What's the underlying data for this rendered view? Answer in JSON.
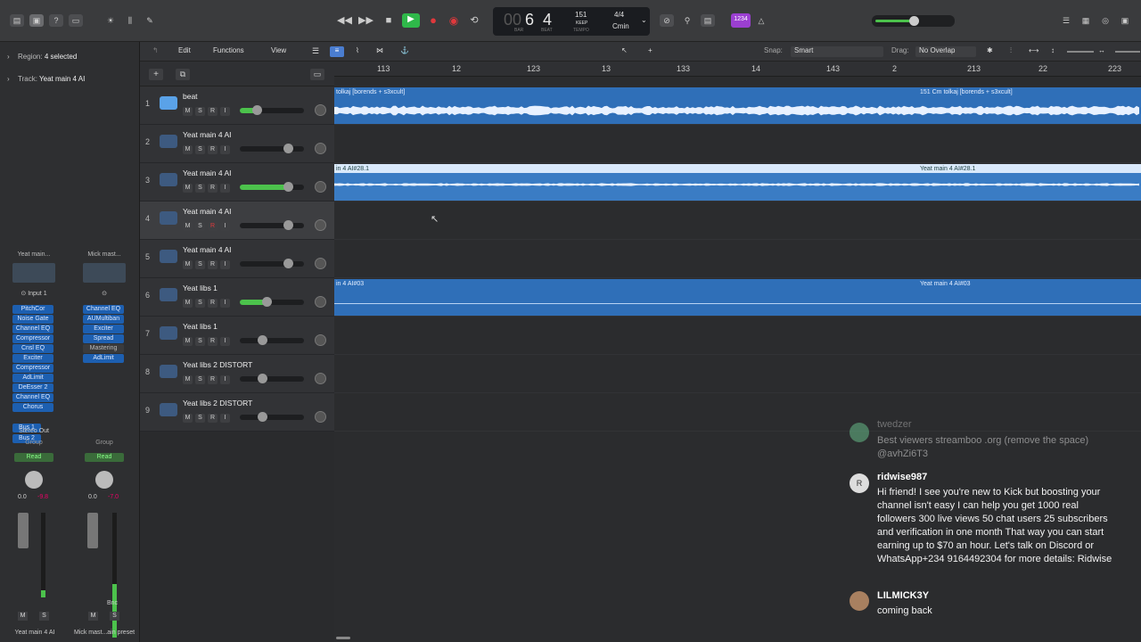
{
  "inspector": {
    "region_label": "Region:",
    "region_value": "4 selected",
    "track_label": "Track:",
    "track_value": "Yeat main 4 AI",
    "strip1": {
      "name": "Yeat main...",
      "input": "Input 1",
      "plugins": [
        "PitchCor",
        "Noise Gate",
        "Channel EQ",
        "Compressor",
        "Cnsl EQ",
        "Exciter",
        "Compressor",
        "AdLimit",
        "DeEsser 2",
        "Channel EQ",
        "Chorus"
      ],
      "sends": [
        "Bus 1",
        "Bus 2"
      ],
      "output": "Stereo Out",
      "group": "Group",
      "automation": "Read",
      "vol_left": "0.0",
      "vol_right": "-9.8",
      "mute": "M",
      "solo": "S",
      "label": "Yeat main 4 AI"
    },
    "strip2": {
      "name": "Mick mast...",
      "plugins": [
        "Channel EQ",
        "AUMultiban",
        "Exciter",
        "Spread",
        "Mastering",
        "AdLimit"
      ],
      "group": "Group",
      "automation": "Read",
      "vol_left": "0.0",
      "vol_right": "-7.0",
      "bounce": "Bnc",
      "mute": "M",
      "solo": "S",
      "label": "Mick mast...ain preset"
    }
  },
  "lcd": {
    "bar": "6",
    "beat": "4",
    "tempo": "151",
    "tempo_sub": "KEEP",
    "signature": "4/4",
    "key": "Cmin",
    "lbl_bar": "BAR",
    "lbl_beat": "BEAT",
    "lbl_tempo": "TEMPO"
  },
  "topbar": {
    "count_in": "1234"
  },
  "toolbar": {
    "edit": "Edit",
    "functions": "Functions",
    "view": "View",
    "snap_label": "Snap:",
    "snap_value": "Smart",
    "drag_label": "Drag:",
    "drag_value": "No Overlap"
  },
  "ruler": [
    "113",
    "12",
    "123",
    "13",
    "133",
    "14",
    "143",
    "2",
    "213",
    "22",
    "223"
  ],
  "tracks": [
    {
      "num": "1",
      "name": "beat",
      "fader": 0.27,
      "green": true
    },
    {
      "num": "2",
      "name": "Yeat main 4 AI",
      "fader": 0.75,
      "green": false
    },
    {
      "num": "3",
      "name": "Yeat main 4 AI",
      "fader": 0.75,
      "green": true
    },
    {
      "num": "4",
      "name": "Yeat main 4 AI",
      "fader": 0.75,
      "green": false
    },
    {
      "num": "5",
      "name": "Yeat main 4 AI",
      "fader": 0.75,
      "green": false
    },
    {
      "num": "6",
      "name": "Yeat libs 1",
      "fader": 0.42,
      "green": true
    },
    {
      "num": "7",
      "name": "Yeat libs 1",
      "fader": 0.35,
      "green": false
    },
    {
      "num": "8",
      "name": "Yeat libs 2 DISTORT",
      "fader": 0.35,
      "green": false
    },
    {
      "num": "9",
      "name": "Yeat libs 2 DISTORT",
      "fader": 0.35,
      "green": false
    }
  ],
  "regions": {
    "r1a": "tolkaj [borends + s3xcult]",
    "r1b": "151 Cm tolkaj [borends + s3xcult]",
    "r3a": "in 4 AI#28.1",
    "r3b": "Yeat main 4 AI#28.1",
    "r6a": "in 4 AI#03",
    "r6b": "Yeat main 4 AI#03"
  },
  "chat": [
    {
      "user": "twedzer",
      "text": "Best viewers streamboo .org (remove the space) @avhZi6T3"
    },
    {
      "user": "ridwise987",
      "avatar_letter": "R",
      "text": "Hi friend! I see you're new to Kick but boosting your channel isn't easy I can help you get 1000 real followers 300 live views 50 chat users 25 subscribers and verification in one month That way you can start earning up to $70 an hour. Let's talk on Discord or WhatsApp+234 9164492304 for more details: Ridwise"
    },
    {
      "user": "LILMICK3Y",
      "text": "coming back"
    }
  ],
  "colors": {
    "region": "#2f6fb8",
    "accent": "#4cc24c",
    "record": "#e0383c",
    "play": "#2fb84a"
  }
}
